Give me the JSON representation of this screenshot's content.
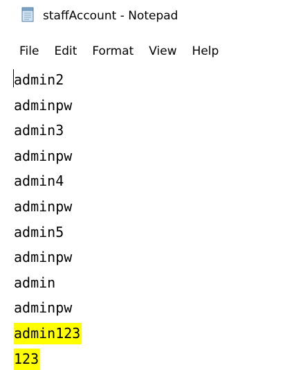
{
  "window": {
    "title": "staffAccount - Notepad",
    "icon": "notepad-icon"
  },
  "menu": {
    "items": [
      "File",
      "Edit",
      "Format",
      "View",
      "Help"
    ]
  },
  "editor": {
    "lines": [
      {
        "text": "admin2",
        "highlighted": false
      },
      {
        "text": "adminpw",
        "highlighted": false
      },
      {
        "text": "admin3",
        "highlighted": false
      },
      {
        "text": "adminpw",
        "highlighted": false
      },
      {
        "text": "admin4",
        "highlighted": false
      },
      {
        "text": "adminpw",
        "highlighted": false
      },
      {
        "text": "admin5",
        "highlighted": false
      },
      {
        "text": "adminpw",
        "highlighted": false
      },
      {
        "text": "admin",
        "highlighted": false
      },
      {
        "text": "adminpw",
        "highlighted": false
      },
      {
        "text": "admin123",
        "highlighted": true
      },
      {
        "text": "123",
        "highlighted": true
      }
    ],
    "highlight_color": "#ffff00"
  }
}
